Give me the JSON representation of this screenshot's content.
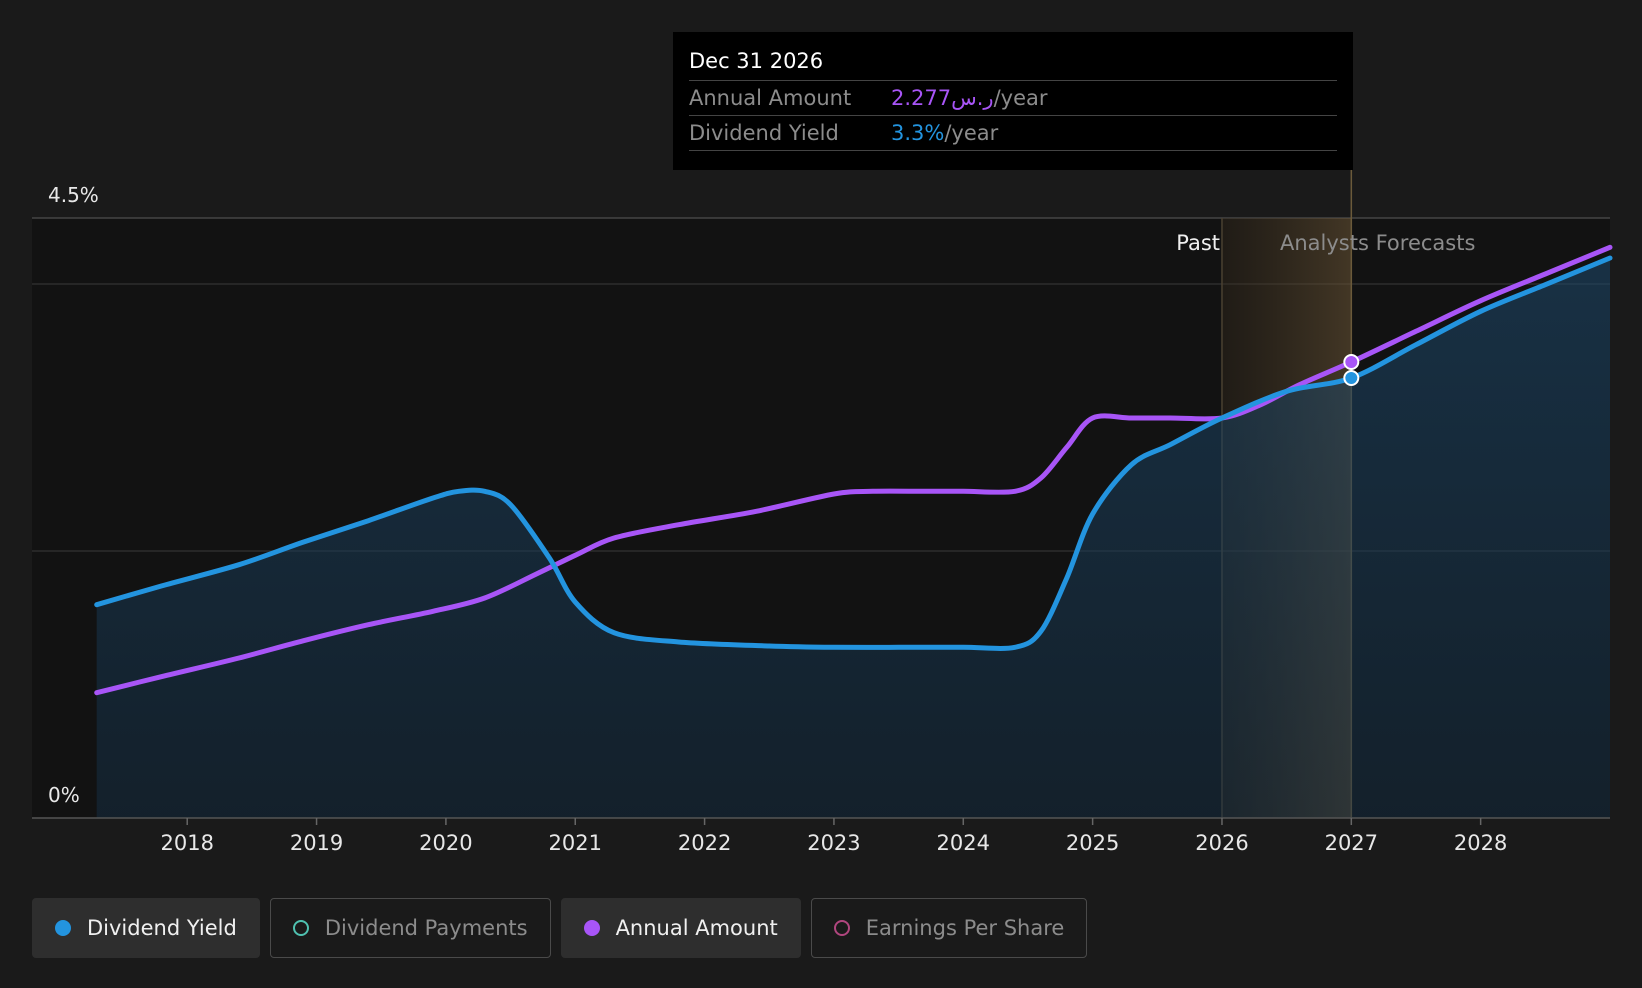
{
  "tooltip": {
    "date": "Dec 31 2026",
    "rows": [
      {
        "label": "Annual Amount",
        "value": "2.277ر.س",
        "unit": "/year"
      },
      {
        "label": "Dividend Yield",
        "value": "3.3%",
        "unit": "/year"
      }
    ]
  },
  "legend": [
    {
      "label": "Dividend Yield",
      "color": "#2394df",
      "active": true
    },
    {
      "label": "Dividend Payments",
      "color": "#4fc1b0",
      "active": false
    },
    {
      "label": "Annual Amount",
      "color": "#a855f7",
      "active": true
    },
    {
      "label": "Earnings Per Share",
      "color": "#b0467e",
      "active": false
    }
  ],
  "chart_data": {
    "type": "line",
    "title": "",
    "xlabel": "",
    "ylabel": "",
    "ylim": [
      0,
      4.5
    ],
    "y_tick_labels": [
      "0%",
      "4.5%"
    ],
    "x_tick_labels": [
      "2018",
      "2019",
      "2020",
      "2021",
      "2022",
      "2023",
      "2024",
      "2025",
      "2026",
      "2027",
      "2028"
    ],
    "x_ticks": [
      2018,
      2019,
      2020,
      2021,
      2022,
      2023,
      2024,
      2025,
      2026,
      2027,
      2028
    ],
    "xlim": [
      2016.8,
      2029.0
    ],
    "grid": true,
    "region_labels": {
      "past": "Past",
      "forecast": "Analysts Forecasts"
    },
    "past_end": 2026.0,
    "highlight_x": 2027.0,
    "series": [
      {
        "name": "Dividend Yield",
        "color": "#2394df",
        "x": [
          2017.3,
          2017.8,
          2018.4,
          2018.9,
          2019.4,
          2019.9,
          2020.1,
          2020.3,
          2020.5,
          2020.8,
          2021.0,
          2021.3,
          2021.8,
          2022.5,
          2023.0,
          2023.5,
          2024.0,
          2024.4,
          2024.6,
          2024.8,
          2025.0,
          2025.3,
          2025.6,
          2026.0,
          2026.5,
          2027.0,
          2027.5,
          2028.0,
          2028.5,
          2029.0
        ],
        "y": [
          1.6,
          1.74,
          1.9,
          2.07,
          2.23,
          2.4,
          2.45,
          2.45,
          2.35,
          1.95,
          1.62,
          1.39,
          1.32,
          1.29,
          1.28,
          1.28,
          1.28,
          1.28,
          1.4,
          1.8,
          2.28,
          2.65,
          2.8,
          3.0,
          3.2,
          3.3,
          3.55,
          3.8,
          4.0,
          4.2
        ]
      },
      {
        "name": "Annual Amount",
        "color": "#a855f7",
        "x": [
          2017.3,
          2017.8,
          2018.4,
          2018.9,
          2019.4,
          2019.9,
          2020.3,
          2020.7,
          2021.0,
          2021.3,
          2021.8,
          2022.4,
          2023.0,
          2023.3,
          2023.7,
          2024.0,
          2024.4,
          2024.6,
          2024.8,
          2025.0,
          2025.3,
          2025.6,
          2026.0,
          2026.3,
          2026.6,
          2027.0,
          2027.5,
          2028.0,
          2028.5,
          2029.0
        ],
        "y": [
          0.94,
          1.06,
          1.2,
          1.33,
          1.45,
          1.55,
          1.65,
          1.83,
          1.97,
          2.1,
          2.2,
          2.3,
          2.43,
          2.45,
          2.45,
          2.45,
          2.45,
          2.55,
          2.78,
          3.0,
          3.0,
          3.0,
          3.0,
          3.1,
          3.25,
          3.42,
          3.65,
          3.88,
          4.08,
          4.28
        ]
      }
    ]
  }
}
